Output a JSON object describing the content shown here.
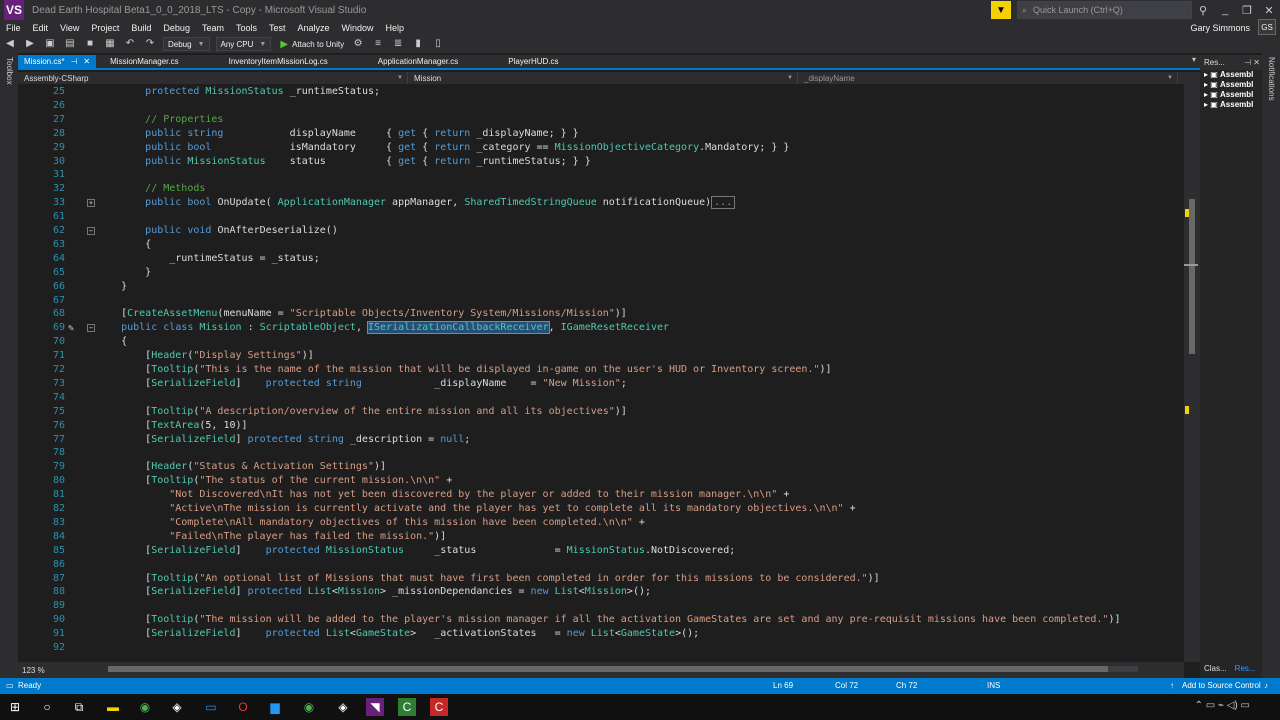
{
  "window": {
    "title": "Dead Earth Hospital Beta1_0_0_2018_LTS - Copy - Microsoft Visual Studio",
    "logo": "VS",
    "quick_launch_placeholder": "Quick Launch (Ctrl+Q)",
    "controls": [
      "_",
      "❐",
      "✕"
    ]
  },
  "menu": {
    "items": [
      "File",
      "Edit",
      "View",
      "Project",
      "Build",
      "Debug",
      "Team",
      "Tools",
      "Test",
      "Analyze",
      "Window",
      "Help"
    ],
    "user": "Gary Simmons",
    "initials": "GS"
  },
  "toolbar": {
    "configuration": "Debug",
    "platform": "Any CPU",
    "attach_label": "Attach to Unity"
  },
  "left_strip_label": "Toolbox",
  "tabs": [
    {
      "label": "Mission.cs*",
      "active": true
    },
    {
      "label": "MissionManager.cs",
      "active": false
    },
    {
      "label": "InventoryItemMissionLog.cs",
      "active": false
    },
    {
      "label": "ApplicationManager.cs",
      "active": false
    },
    {
      "label": "PlayerHUD.cs",
      "active": false
    }
  ],
  "navbar": {
    "project": "Assembly-CSharp",
    "type": "Mission",
    "member": "_displayName"
  },
  "code_lines": [
    {
      "num": "25",
      "text": "        protected MissionStatus _runtimeStatus;"
    },
    {
      "num": "26",
      "text": ""
    },
    {
      "num": "27",
      "text": "        // Properties"
    },
    {
      "num": "28",
      "text": "        public string           displayName     { get { return _displayName; } }"
    },
    {
      "num": "29",
      "text": "        public bool             isMandatory     { get { return _category == MissionObjectiveCategory.Mandatory; } }"
    },
    {
      "num": "30",
      "text": "        public MissionStatus    status          { get { return _runtimeStatus; } }"
    },
    {
      "num": "31",
      "text": ""
    },
    {
      "num": "32",
      "text": "        // Methods"
    },
    {
      "num": "33",
      "text": "        public bool OnUpdate( ApplicationManager appManager, SharedTimedStringQueue notificationQueue)..."
    },
    {
      "num": "61",
      "text": ""
    },
    {
      "num": "62",
      "text": "        public void OnAfterDeserialize()"
    },
    {
      "num": "63",
      "text": "        {"
    },
    {
      "num": "64",
      "text": "            _runtimeStatus = _status;"
    },
    {
      "num": "65",
      "text": "        }"
    },
    {
      "num": "66",
      "text": "    }"
    },
    {
      "num": "67",
      "text": ""
    },
    {
      "num": "68",
      "text": "    [CreateAssetMenu(menuName = \"Scriptable Objects/Inventory System/Missions/Mission\")]"
    },
    {
      "num": "69",
      "text": "    public class Mission : ScriptableObject, ISerializationCallbackReceiver, IGameResetReceiver"
    },
    {
      "num": "70",
      "text": "    {"
    },
    {
      "num": "71",
      "text": "        [Header(\"Display Settings\")]"
    },
    {
      "num": "72",
      "text": "        [Tooltip(\"This is the name of the mission that will be displayed in-game on the user's HUD or Inventory screen.\")]"
    },
    {
      "num": "73",
      "text": "        [SerializeField]    protected string            _displayName    = \"New Mission\";"
    },
    {
      "num": "74",
      "text": ""
    },
    {
      "num": "75",
      "text": "        [Tooltip(\"A description/overview of the entire mission and all its objectives\")]"
    },
    {
      "num": "76",
      "text": "        [TextArea(5, 10)]"
    },
    {
      "num": "77",
      "text": "        [SerializeField] protected string _description = null;"
    },
    {
      "num": "78",
      "text": ""
    },
    {
      "num": "79",
      "text": "        [Header(\"Status & Activation Settings\")]"
    },
    {
      "num": "80",
      "text": "        [Tooltip(\"The status of the current mission.\\n\\n\" +"
    },
    {
      "num": "81",
      "text": "            \"Not Discovered\\nIt has not yet been discovered by the player or added to their mission manager.\\n\\n\" +"
    },
    {
      "num": "82",
      "text": "            \"Active\\nThe mission is currently activate and the player has yet to complete all its mandatory objectives.\\n\\n\" +"
    },
    {
      "num": "83",
      "text": "            \"Complete\\nAll mandatory objectives of this mission have been completed.\\n\\n\" +"
    },
    {
      "num": "84",
      "text": "            \"Failed\\nThe player has failed the mission.\")]"
    },
    {
      "num": "85",
      "text": "        [SerializeField]    protected MissionStatus     _status             = MissionStatus.NotDiscovered;"
    },
    {
      "num": "86",
      "text": ""
    },
    {
      "num": "87",
      "text": "        [Tooltip(\"An optional list of Missions that must have first been completed in order for this missions to be considered.\")]"
    },
    {
      "num": "88",
      "text": "        [SerializeField] protected List<Mission> _missionDependancies = new List<Mission>();"
    },
    {
      "num": "89",
      "text": ""
    },
    {
      "num": "90",
      "text": "        [Tooltip(\"The mission will be added to the player's mission manager if all the activation GameStates are set and any pre-requisit missions have been completed.\")]"
    },
    {
      "num": "91",
      "text": "        [SerializeField]    protected List<GameState>   _activationStates   = new List<GameState>();"
    },
    {
      "num": "92",
      "text": ""
    }
  ],
  "zoom": "123 %",
  "solution_explorer": {
    "header": "Res...",
    "items": [
      "Assembl",
      "Assembl",
      "Assembl",
      "Assembl"
    ],
    "tabs": [
      "Clas...",
      "Res..."
    ]
  },
  "right_strip_label": "Notifications",
  "status": {
    "state": "Ready",
    "line": "Ln 69",
    "col": "Col 72",
    "ch": "Ch 72",
    "mode": "INS",
    "source_control": "Add to Source Control"
  },
  "colors": {
    "accent": "#007acc",
    "keyword": "#569cd6",
    "type": "#4ec9b0",
    "string": "#d69d85",
    "comment": "#57a64a",
    "line_number": "#2b91af"
  }
}
